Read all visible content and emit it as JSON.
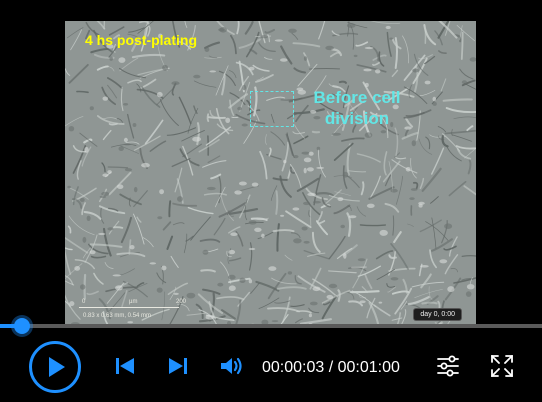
{
  "video": {
    "overlay_title": "4 hs post-plating",
    "roi_label_line1": "Before cell",
    "roi_label_line2": "division",
    "scale_ticks": [
      "0",
      "µm",
      "200"
    ],
    "scale_dims": "0.83 x 0.63 mm, 0.54 mm",
    "timestamp": "day 0, 0:00"
  },
  "player": {
    "progress": 0.05,
    "current_time": "00:00:03",
    "separator": " / ",
    "duration": "00:01:00",
    "accent_color": "#1e90ff",
    "icons": [
      "play-icon",
      "skip-previous-icon",
      "skip-next-icon",
      "volume-icon",
      "settings-sliders-icon",
      "fullscreen-icon"
    ]
  }
}
